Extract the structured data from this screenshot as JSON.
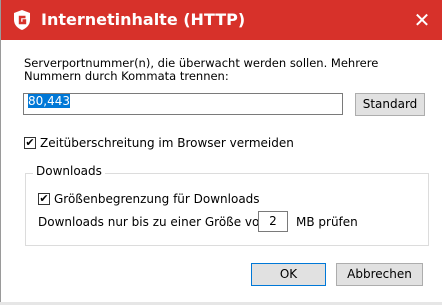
{
  "window": {
    "title": "Internetinhalte (HTTP)",
    "close_glyph": "✕",
    "logo_icon": "gdata-shield-icon",
    "accent_color": "#d7312a"
  },
  "ports": {
    "description": "Serverportnummer(n), die überwacht werden sollen. Mehrere Nummern durch Kommata trennen:",
    "value": "80,443",
    "default_button": "Standard"
  },
  "timeout": {
    "checked": true,
    "label": "Zeitüberschreitung im Browser vermeiden"
  },
  "downloads": {
    "group_title": "Downloads",
    "size_limit_checked": true,
    "size_limit_label": "Größenbegrenzung für Downloads",
    "size_prefix": "Downloads nur bis zu einer Größe von",
    "size_value": "2",
    "size_suffix": "MB prüfen"
  },
  "buttons": {
    "ok": "OK",
    "cancel": "Abbrechen"
  },
  "checkmark_glyph": "✔"
}
